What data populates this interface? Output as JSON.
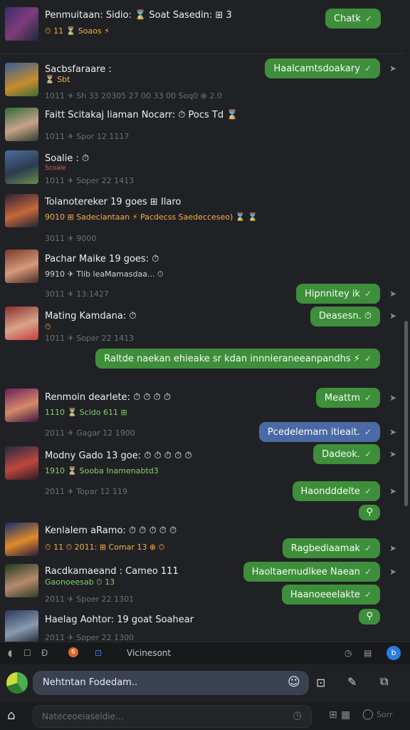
{
  "header_row": {
    "name": "Penmuitaan: Sidio: ⌛ Soat Sasedin: ⊞ 3",
    "sub": "⏱ 11 ⏳ Soaos ⚡",
    "bubble": "Chatk"
  },
  "rows": [
    {
      "name": "Sacbsfaraare :",
      "sub": "⏳ Sbt",
      "meta": "1011 ✈ Sh 33 20305 27 00 33 00 Soq0 ⊕ 2.0",
      "bubble": "Haalcamtsdoakary",
      "bubble_color": "green"
    },
    {
      "name": "Faitt Scitakaj Iiaman Nocarr: ⏱ Pocs Td ⌛",
      "sub": "",
      "meta": "1011 ✈ Spor 12 1117",
      "bubble": "",
      "bubble_color": "green"
    },
    {
      "name": "Soalie : ⏱",
      "sub": "Scoale",
      "meta": "1011 ✈ Soper 22 1413",
      "bubble": "",
      "bubble_color": "green"
    },
    {
      "name": "Tolanotereker 19 goes ⊞ Ilaro",
      "sub": "9010 ⊞ Sadeciantaan ⚡ Pacdecss Saedecceseo) ⌛ ⌛",
      "meta": "3011 ✈ 9000",
      "bubble": "",
      "bubble_color": "green"
    },
    {
      "name": "Pachar Maike 19 goes: ⏱",
      "sub": "9910 ✈ Tlib leaMamasdaa... ⏱",
      "meta": "3011 ✈ 13:1427",
      "bubble": "Hipnnitey ik",
      "bubble_color": "green"
    },
    {
      "name": "Mating Kamdana: ⏱",
      "sub": "⏱",
      "meta": "1011 ✈ Soper 22 1413",
      "bubble": "Deasesn. ⏱",
      "bubble_color": "green"
    },
    {
      "name": "",
      "sub": "",
      "meta": "",
      "bubble": "Raltde naekan ehieake sr kdan innnieraneeanpandhs ⚡",
      "bubble_color": "green"
    },
    {
      "name": "Renmoin dearlete: ⏱ ⏱ ⏱ ⏱",
      "sub": "1110 ⏳ Scldo 611 ⊞",
      "meta": "2011 ✈ Gagar 12 1900",
      "bubble": "Meattm",
      "bubble_color": "green"
    },
    {
      "name": "",
      "sub": "",
      "meta": "",
      "bubble": "Pcedelemarn itieait.",
      "bubble_color": "blue"
    },
    {
      "name": "Modny Gado 13 goe: ⏱ ⏱ ⏱ ⏱ ⏱",
      "sub": "1910 ⏳ Sooba Inamenabtd3",
      "meta": "2011 ✈ Topar 12 119",
      "bubble": "Dadeok.",
      "bubble_color": "green"
    },
    {
      "name": "",
      "sub": "",
      "meta": "",
      "bubble": "Haondddelte",
      "bubble_color": "green"
    },
    {
      "name": "",
      "sub": "",
      "meta": "",
      "bubble": "⚲",
      "bubble_color": "green"
    },
    {
      "name": "Kenlalem aRamo: ⏱ ⏱ ⏱ ⏱ ⏱",
      "sub": "⏱ 11 ⏱ 2011: ⊞ Comar 13 ⊕ ⏱",
      "meta": "",
      "bubble": "Ragbediaamak",
      "bubble_color": "green"
    },
    {
      "name": "Racdkamaeand : Cameo 111",
      "sub": "Gaonoeesab ⏱ 13",
      "meta": "2011 ✈ Spoer 22 1301",
      "bubble": "Haoltaemudlkee Naean",
      "bubble_color": "green"
    },
    {
      "name": "",
      "sub": "",
      "meta": "",
      "bubble": "Haanoeeelakte",
      "bubble_color": "green"
    },
    {
      "name": "Haelag Aohtor: 19 goat Soahear",
      "sub": "",
      "meta": "2011 ✈ Soper 22 1300",
      "bubble": "⚲",
      "bubble_color": "green"
    }
  ],
  "toolbar": {
    "label": "Vicinesont"
  },
  "composer": {
    "input_value": "Nehtntan Fodedam..",
    "bottom_placeholder": "Nateceoeiaseldie...",
    "bottom_right": "Sorr"
  },
  "colors": {
    "background": "#202124",
    "bubble_green": "#3e8e3b",
    "bubble_blue": "#4b6aa5",
    "input": "#3a4252"
  },
  "icons": [
    "share-icon",
    "check-icon",
    "send-icon",
    "home-icon",
    "emoji-icon",
    "attach-icon",
    "pen-icon",
    "sticker-icon",
    "clock-icon"
  ]
}
